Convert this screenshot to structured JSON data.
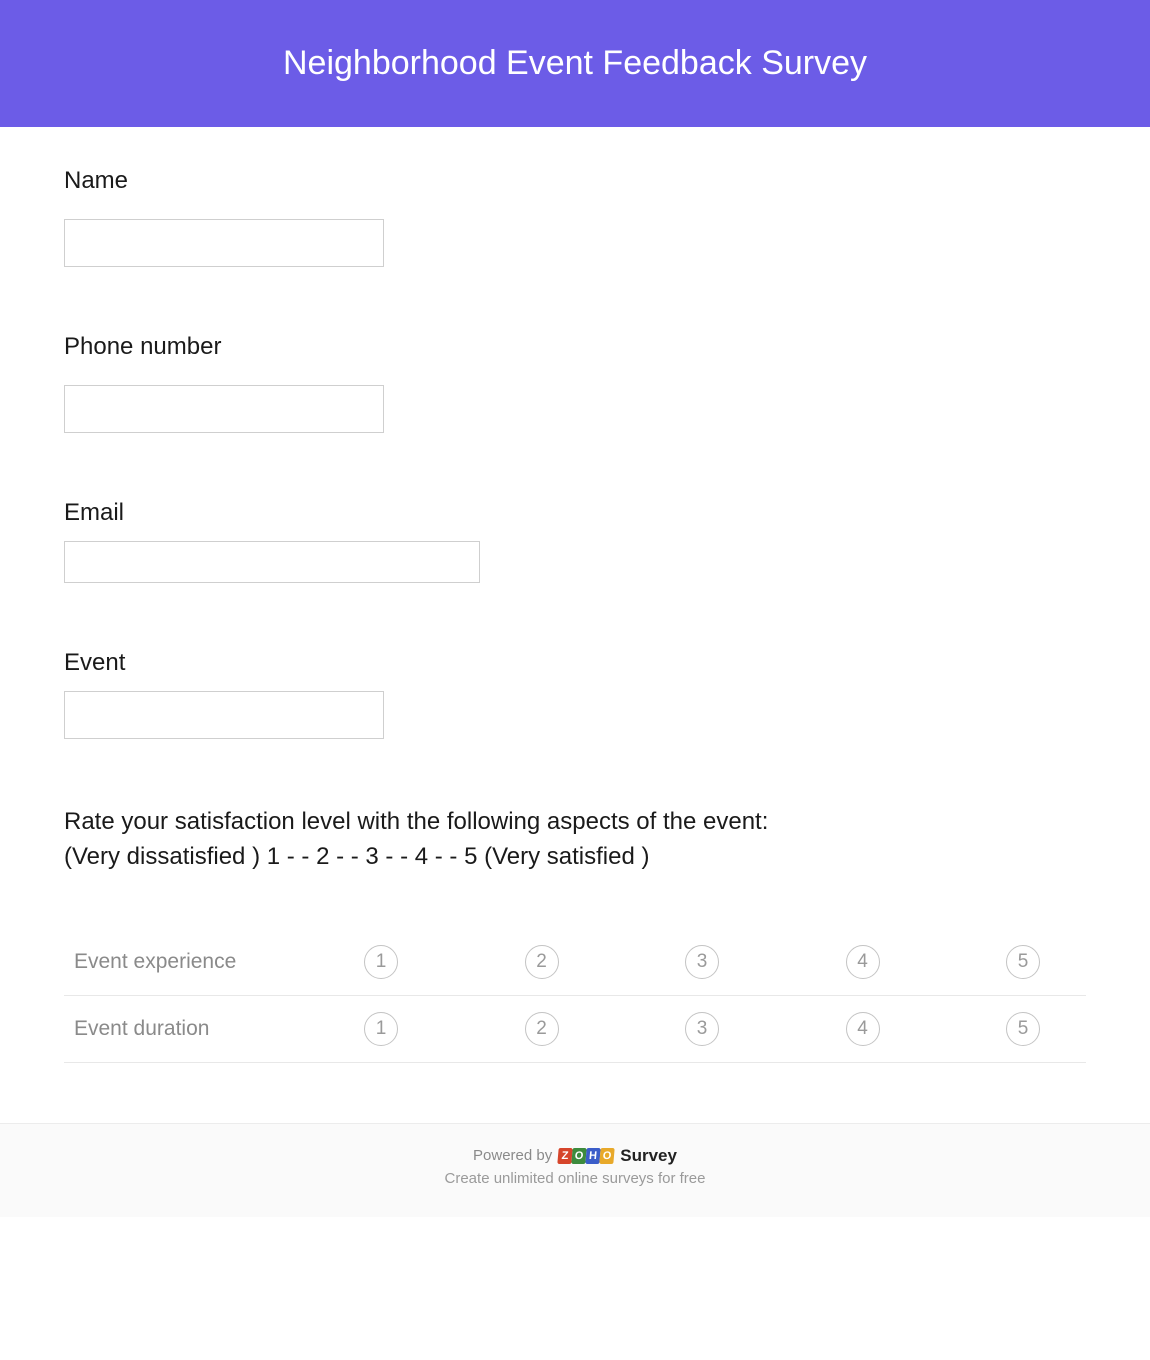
{
  "header": {
    "title": "Neighborhood Event Feedback Survey"
  },
  "questions": {
    "name": {
      "label": "Name",
      "value": ""
    },
    "phone": {
      "label": "Phone number",
      "value": ""
    },
    "email": {
      "label": "Email",
      "value": ""
    },
    "event": {
      "label": "Event",
      "value": ""
    }
  },
  "rating": {
    "intro_line1": "Rate your satisfaction level with the following aspects of the event:",
    "intro_line2": "(Very dissatisfied ) 1 - - 2 - - 3 - - 4 - - 5 (Very satisfied )",
    "options": [
      "1",
      "2",
      "3",
      "4",
      "5"
    ],
    "rows": [
      {
        "label": "Event experience"
      },
      {
        "label": "Event duration"
      }
    ]
  },
  "footer": {
    "powered_by": "Powered by",
    "brand_suffix": "Survey",
    "subtext": "Create unlimited online surveys for free",
    "logo_letters": [
      "Z",
      "O",
      "H",
      "O"
    ]
  }
}
